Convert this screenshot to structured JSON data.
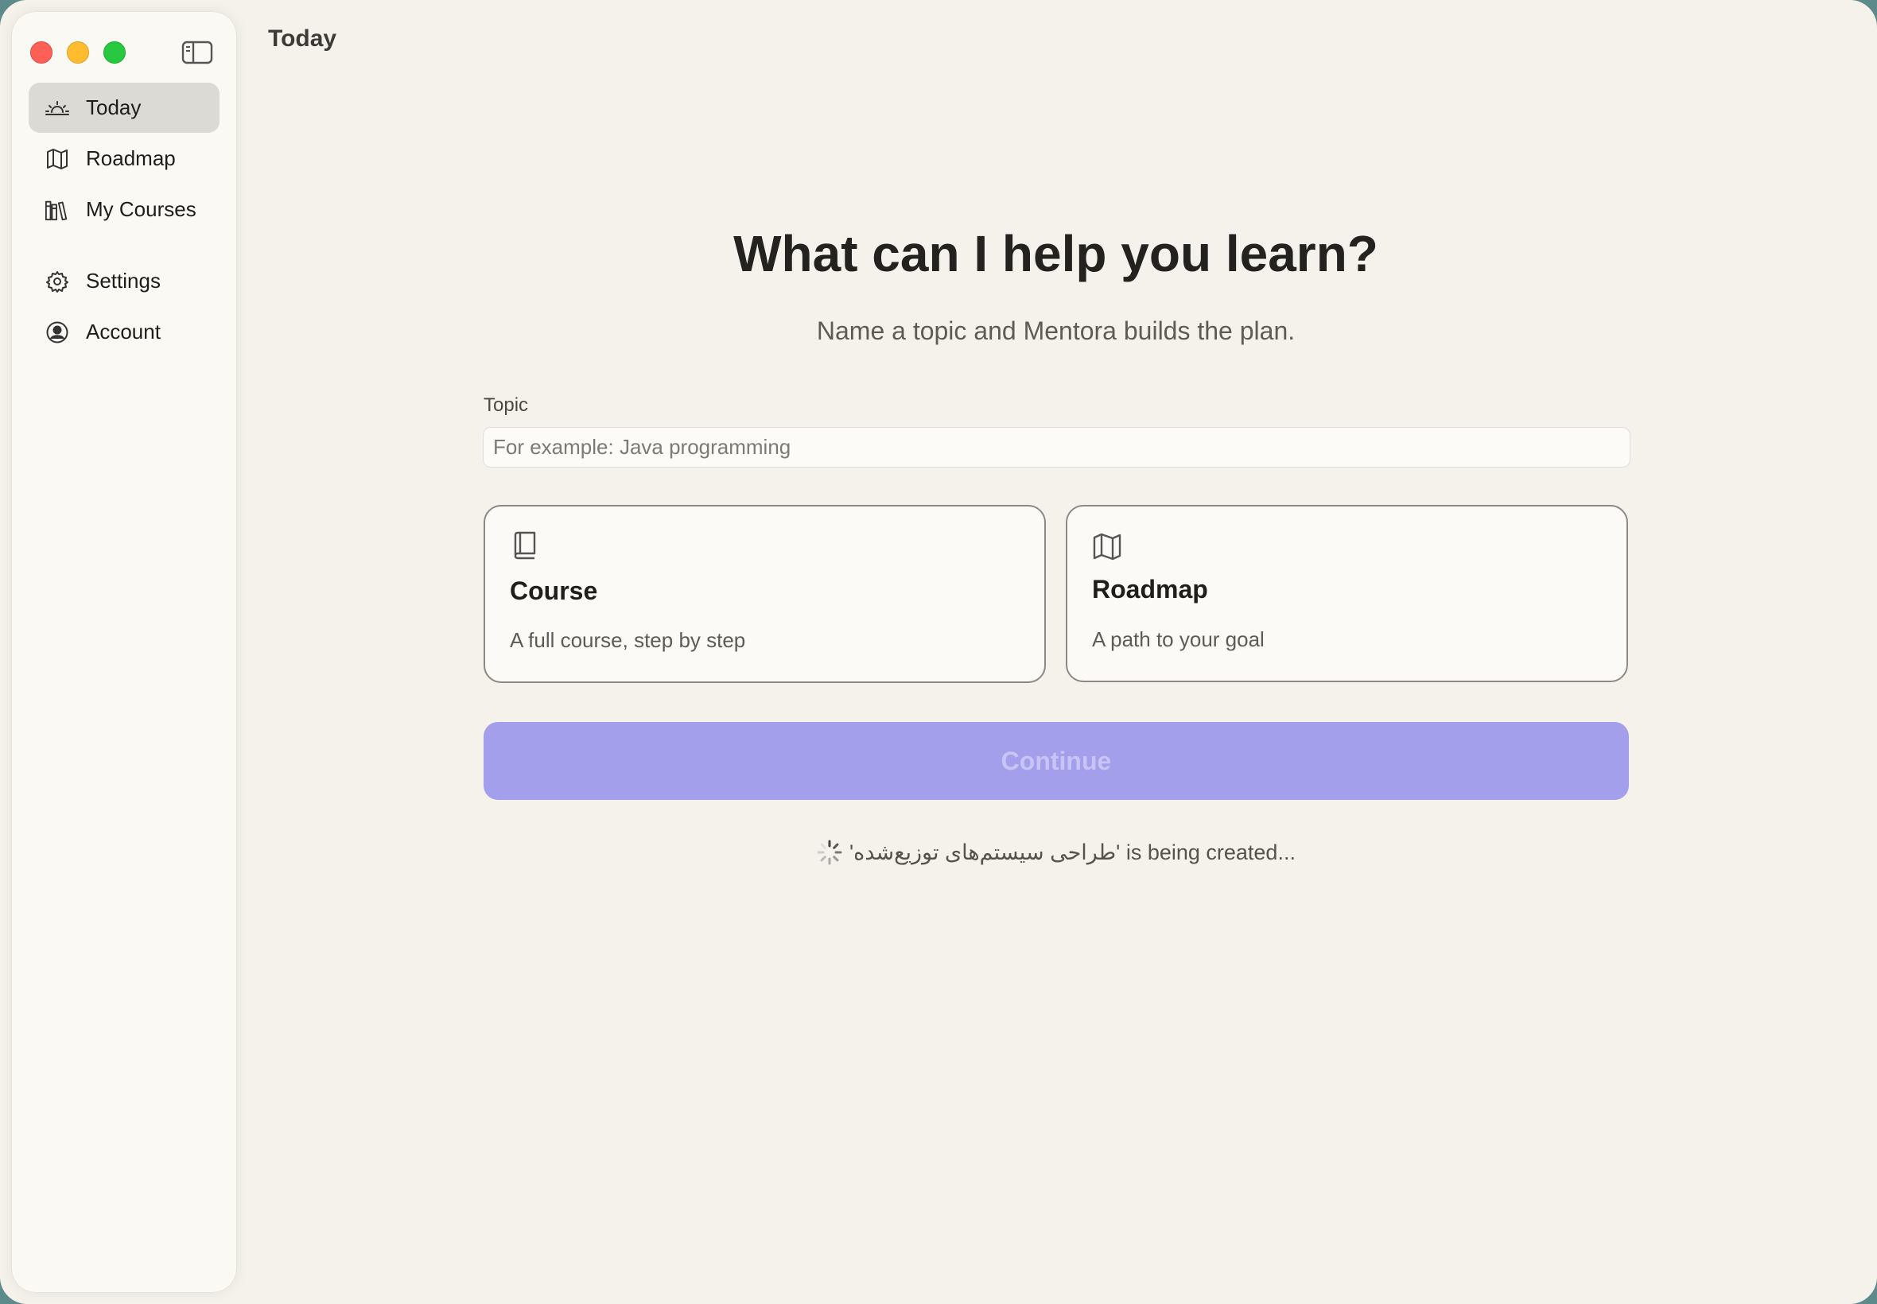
{
  "window": {
    "title": "Today"
  },
  "sidebar": {
    "items": [
      {
        "label": "Today",
        "icon": "sunrise-icon",
        "active": true
      },
      {
        "label": "Roadmap",
        "icon": "map-icon",
        "active": false
      },
      {
        "label": "My Courses",
        "icon": "books-icon",
        "active": false
      },
      {
        "label": "Settings",
        "icon": "gear-icon",
        "active": false
      },
      {
        "label": "Account",
        "icon": "person-circle-icon",
        "active": false
      }
    ]
  },
  "main": {
    "headline": "What can I help you learn?",
    "subhead": "Name a topic and Mentora builds the plan.",
    "topic": {
      "label": "Topic",
      "value": "",
      "placeholder": "For example: Java programming"
    },
    "cards": {
      "course": {
        "title": "Course",
        "description": "A full course, step by step",
        "icon": "book-icon"
      },
      "roadmap": {
        "title": "Roadmap",
        "description": "A path to your goal",
        "icon": "map-icon"
      }
    },
    "continue_label": "Continue",
    "status_text": "'طراحی سیستم‌های توزیع‌شده' is being created..."
  },
  "colors": {
    "accent": "#a49feb",
    "background": "#f5f2eb",
    "sidebar": "#fbf9f4"
  }
}
